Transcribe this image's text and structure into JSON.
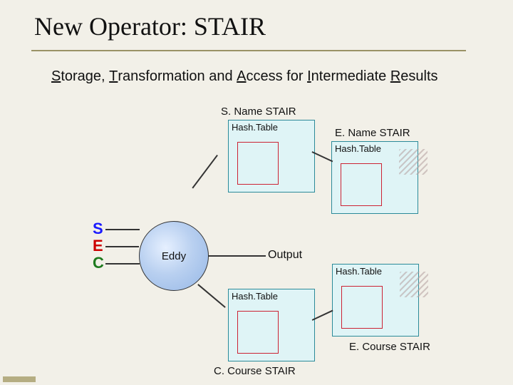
{
  "title": "New Operator: STAIR",
  "subtitle": {
    "s": "S",
    "rest1": "torage, ",
    "t": "T",
    "rest2": "ransformation and ",
    "a": "A",
    "rest3": "ccess for ",
    "i": "I",
    "rest4": "ntermediate ",
    "r": "R",
    "rest5": "esults"
  },
  "sources": {
    "s": "S",
    "e": "E",
    "c": "C"
  },
  "eddy_label": "Eddy",
  "output_label": "Output",
  "hash_label": "Hash.Table",
  "stairs": {
    "s_name": "S. Name STAIR",
    "e_name": "E. Name STAIR",
    "c_course": "C. Course STAIR",
    "e_course": "E. Course STAIR"
  }
}
